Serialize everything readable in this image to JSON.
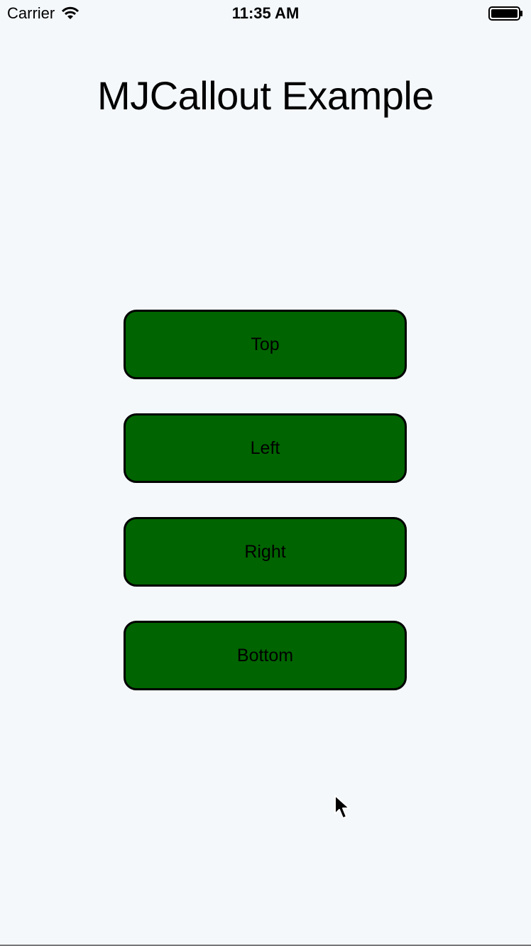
{
  "status_bar": {
    "carrier": "Carrier",
    "time": "11:35 AM",
    "icons": [
      "wifi-icon",
      "battery-icon"
    ]
  },
  "page": {
    "title": "MJCallout Example"
  },
  "buttons": [
    {
      "label": "Top"
    },
    {
      "label": "Left"
    },
    {
      "label": "Right"
    },
    {
      "label": "Bottom"
    }
  ],
  "colors": {
    "background": "#f4f8fb",
    "button_fill": "#006400",
    "button_border": "#000000",
    "text": "#000000"
  },
  "cursor": {
    "icon": "pointer-arrow-icon"
  }
}
